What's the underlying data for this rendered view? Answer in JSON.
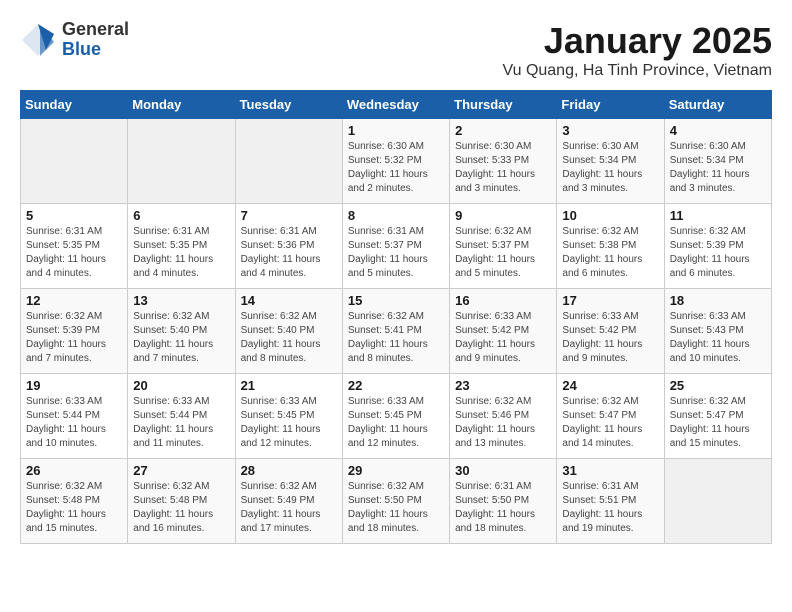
{
  "header": {
    "logo_general": "General",
    "logo_blue": "Blue",
    "title": "January 2025",
    "subtitle": "Vu Quang, Ha Tinh Province, Vietnam"
  },
  "days_of_week": [
    "Sunday",
    "Monday",
    "Tuesday",
    "Wednesday",
    "Thursday",
    "Friday",
    "Saturday"
  ],
  "weeks": [
    [
      {
        "day": "",
        "info": ""
      },
      {
        "day": "",
        "info": ""
      },
      {
        "day": "",
        "info": ""
      },
      {
        "day": "1",
        "info": "Sunrise: 6:30 AM\nSunset: 5:32 PM\nDaylight: 11 hours\nand 2 minutes."
      },
      {
        "day": "2",
        "info": "Sunrise: 6:30 AM\nSunset: 5:33 PM\nDaylight: 11 hours\nand 3 minutes."
      },
      {
        "day": "3",
        "info": "Sunrise: 6:30 AM\nSunset: 5:34 PM\nDaylight: 11 hours\nand 3 minutes."
      },
      {
        "day": "4",
        "info": "Sunrise: 6:30 AM\nSunset: 5:34 PM\nDaylight: 11 hours\nand 3 minutes."
      }
    ],
    [
      {
        "day": "5",
        "info": "Sunrise: 6:31 AM\nSunset: 5:35 PM\nDaylight: 11 hours\nand 4 minutes."
      },
      {
        "day": "6",
        "info": "Sunrise: 6:31 AM\nSunset: 5:35 PM\nDaylight: 11 hours\nand 4 minutes."
      },
      {
        "day": "7",
        "info": "Sunrise: 6:31 AM\nSunset: 5:36 PM\nDaylight: 11 hours\nand 4 minutes."
      },
      {
        "day": "8",
        "info": "Sunrise: 6:31 AM\nSunset: 5:37 PM\nDaylight: 11 hours\nand 5 minutes."
      },
      {
        "day": "9",
        "info": "Sunrise: 6:32 AM\nSunset: 5:37 PM\nDaylight: 11 hours\nand 5 minutes."
      },
      {
        "day": "10",
        "info": "Sunrise: 6:32 AM\nSunset: 5:38 PM\nDaylight: 11 hours\nand 6 minutes."
      },
      {
        "day": "11",
        "info": "Sunrise: 6:32 AM\nSunset: 5:39 PM\nDaylight: 11 hours\nand 6 minutes."
      }
    ],
    [
      {
        "day": "12",
        "info": "Sunrise: 6:32 AM\nSunset: 5:39 PM\nDaylight: 11 hours\nand 7 minutes."
      },
      {
        "day": "13",
        "info": "Sunrise: 6:32 AM\nSunset: 5:40 PM\nDaylight: 11 hours\nand 7 minutes."
      },
      {
        "day": "14",
        "info": "Sunrise: 6:32 AM\nSunset: 5:40 PM\nDaylight: 11 hours\nand 8 minutes."
      },
      {
        "day": "15",
        "info": "Sunrise: 6:32 AM\nSunset: 5:41 PM\nDaylight: 11 hours\nand 8 minutes."
      },
      {
        "day": "16",
        "info": "Sunrise: 6:33 AM\nSunset: 5:42 PM\nDaylight: 11 hours\nand 9 minutes."
      },
      {
        "day": "17",
        "info": "Sunrise: 6:33 AM\nSunset: 5:42 PM\nDaylight: 11 hours\nand 9 minutes."
      },
      {
        "day": "18",
        "info": "Sunrise: 6:33 AM\nSunset: 5:43 PM\nDaylight: 11 hours\nand 10 minutes."
      }
    ],
    [
      {
        "day": "19",
        "info": "Sunrise: 6:33 AM\nSunset: 5:44 PM\nDaylight: 11 hours\nand 10 minutes."
      },
      {
        "day": "20",
        "info": "Sunrise: 6:33 AM\nSunset: 5:44 PM\nDaylight: 11 hours\nand 11 minutes."
      },
      {
        "day": "21",
        "info": "Sunrise: 6:33 AM\nSunset: 5:45 PM\nDaylight: 11 hours\nand 12 minutes."
      },
      {
        "day": "22",
        "info": "Sunrise: 6:33 AM\nSunset: 5:45 PM\nDaylight: 11 hours\nand 12 minutes."
      },
      {
        "day": "23",
        "info": "Sunrise: 6:32 AM\nSunset: 5:46 PM\nDaylight: 11 hours\nand 13 minutes."
      },
      {
        "day": "24",
        "info": "Sunrise: 6:32 AM\nSunset: 5:47 PM\nDaylight: 11 hours\nand 14 minutes."
      },
      {
        "day": "25",
        "info": "Sunrise: 6:32 AM\nSunset: 5:47 PM\nDaylight: 11 hours\nand 15 minutes."
      }
    ],
    [
      {
        "day": "26",
        "info": "Sunrise: 6:32 AM\nSunset: 5:48 PM\nDaylight: 11 hours\nand 15 minutes."
      },
      {
        "day": "27",
        "info": "Sunrise: 6:32 AM\nSunset: 5:48 PM\nDaylight: 11 hours\nand 16 minutes."
      },
      {
        "day": "28",
        "info": "Sunrise: 6:32 AM\nSunset: 5:49 PM\nDaylight: 11 hours\nand 17 minutes."
      },
      {
        "day": "29",
        "info": "Sunrise: 6:32 AM\nSunset: 5:50 PM\nDaylight: 11 hours\nand 18 minutes."
      },
      {
        "day": "30",
        "info": "Sunrise: 6:31 AM\nSunset: 5:50 PM\nDaylight: 11 hours\nand 18 minutes."
      },
      {
        "day": "31",
        "info": "Sunrise: 6:31 AM\nSunset: 5:51 PM\nDaylight: 11 hours\nand 19 minutes."
      },
      {
        "day": "",
        "info": ""
      }
    ]
  ]
}
